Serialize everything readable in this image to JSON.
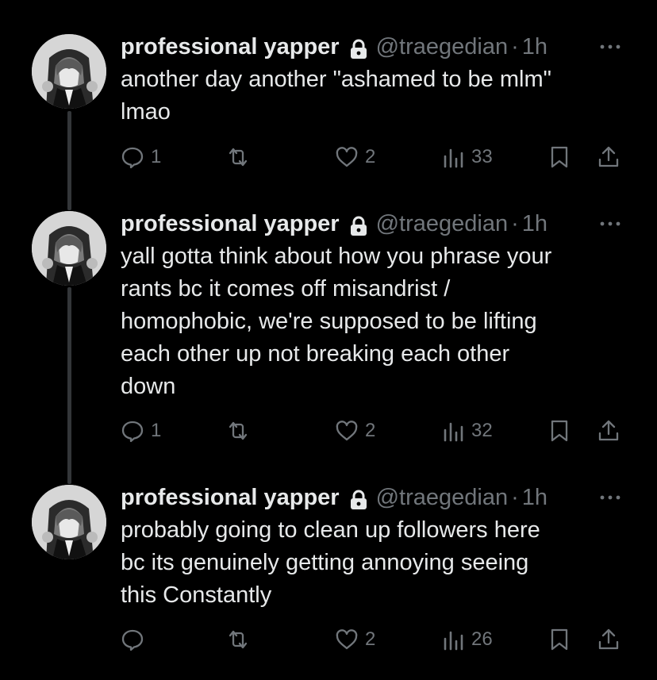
{
  "thread": {
    "tweets": [
      {
        "display_name": "professional yapper",
        "handle": "@traegedian",
        "separator": "·",
        "time": "1h",
        "text": "another day another \"ashamed to be mlm\"\nlmao",
        "replies": "1",
        "retweets": "",
        "likes": "2",
        "views": "33"
      },
      {
        "display_name": "professional yapper",
        "handle": "@traegedian",
        "separator": "·",
        "time": "1h",
        "text": "yall gotta think about how you phrase your\nrants bc it comes off misandrist /\nhomophobic, we're supposed to be lifting\neach other up not breaking each other\ndown",
        "replies": "1",
        "retweets": "",
        "likes": "2",
        "views": "32"
      },
      {
        "display_name": "professional yapper",
        "handle": "@traegedian",
        "separator": "·",
        "time": "1h",
        "text": "probably going to clean up followers here\nbc its genuinely getting annoying seeing\nthis Constantly",
        "replies": "",
        "retweets": "",
        "likes": "2",
        "views": "26"
      }
    ]
  },
  "colors": {
    "background": "#000000",
    "text_primary": "#e7e9ea",
    "text_secondary": "#71767b",
    "thread_line": "#333639"
  },
  "icons": [
    "lock-icon",
    "more-icon",
    "reply-icon",
    "retweet-icon",
    "like-icon",
    "views-icon",
    "bookmark-icon",
    "share-icon"
  ]
}
